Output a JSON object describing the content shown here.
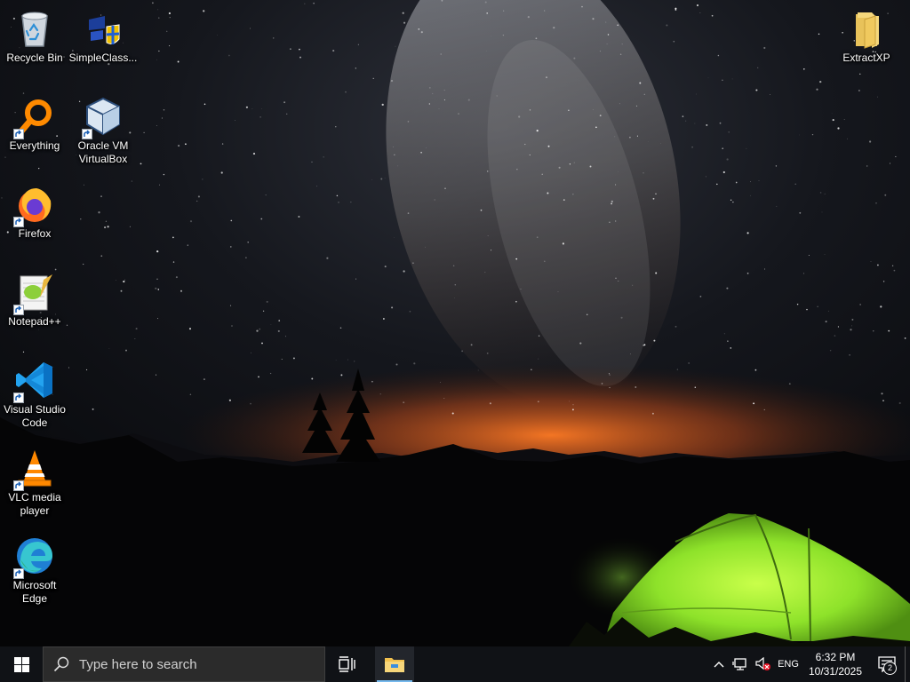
{
  "desktop": {
    "icons": [
      {
        "label": "Recycle Bin",
        "icon": "recycle-bin-icon"
      },
      {
        "label": "SimpleClass...",
        "icon": "simpleclassic-icon"
      },
      {
        "label": "ExtractXP",
        "icon": "folder-icon"
      },
      {
        "label": "Everything",
        "icon": "everything-icon"
      },
      {
        "label": "Oracle VM VirtualBox",
        "icon": "virtualbox-icon"
      },
      {
        "label": "Firefox",
        "icon": "firefox-icon"
      },
      {
        "label": "Notepad++",
        "icon": "notepadpp-icon"
      },
      {
        "label": "Visual Studio Code",
        "icon": "vscode-icon"
      },
      {
        "label": "VLC media player",
        "icon": "vlc-icon"
      },
      {
        "label": "Microsoft Edge",
        "icon": "edge-icon"
      }
    ]
  },
  "taskbar": {
    "search_placeholder": "Type here to search",
    "pinned": [
      {
        "name": "File Explorer",
        "icon": "file-explorer-icon",
        "running": true
      }
    ],
    "tray": {
      "language": "ENG",
      "time": "6:32 PM",
      "date": "10/31/2025",
      "notification_count": "2"
    }
  },
  "colors": {
    "taskbar_bg": "#101216",
    "search_bg": "#2b2b2b",
    "accent": "#76b9ed",
    "tent_green": "#8ee22a"
  }
}
